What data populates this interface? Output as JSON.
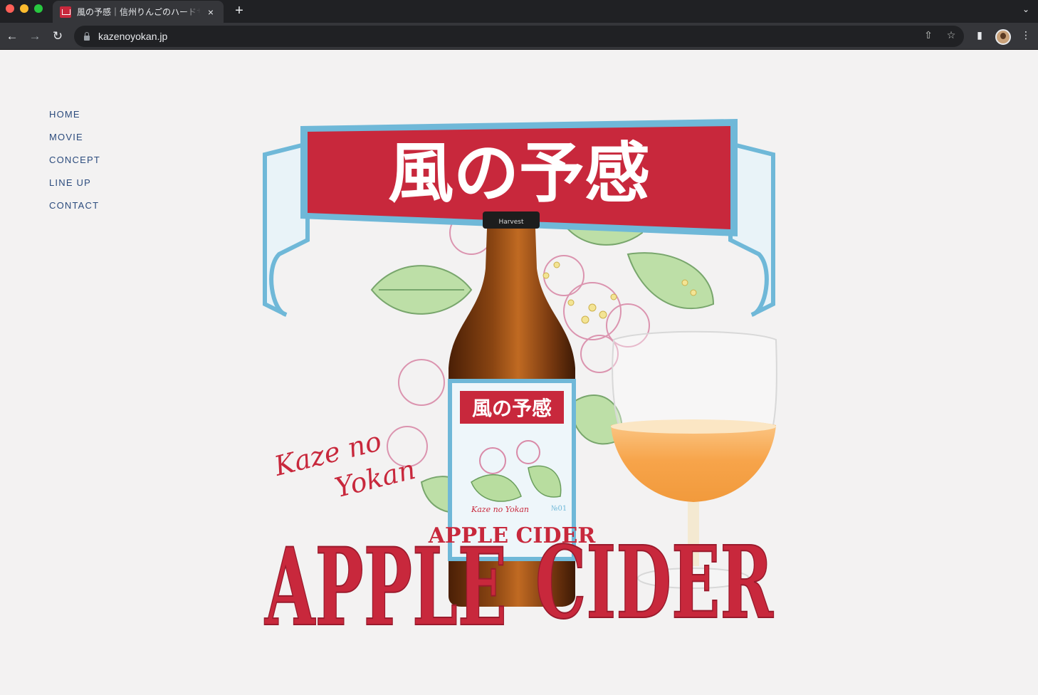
{
  "browser": {
    "tab_title": "風の予感｜信州りんごのハードサイダー",
    "tab_close": "×",
    "new_tab": "+",
    "url": "kazenoyokan.jp"
  },
  "nav": {
    "items": [
      {
        "label": "HOME"
      },
      {
        "label": "MOVIE"
      },
      {
        "label": "CONCEPT"
      },
      {
        "label": "LINE UP"
      },
      {
        "label": "CONTACT"
      }
    ]
  },
  "hero": {
    "banner_text": "風の予感",
    "label_banner": "風の予感",
    "script_line1": "Kaze no",
    "script_line2": "Yokan",
    "label_script": "Kaze no Yokan",
    "label_cider": "APPLE CIDER",
    "label_number": "№01",
    "cap_text": "Harvest",
    "big_word1": "APPLE",
    "big_word2": "CIDER"
  },
  "colors": {
    "brand_red": "#c8283c",
    "banner_blue": "#6fb8d8",
    "leaf_green": "#9bcc86",
    "nav_blue": "#2b4b7d",
    "cider_amber": "#f7a44a",
    "bottle_brown": "#7a3a10"
  }
}
